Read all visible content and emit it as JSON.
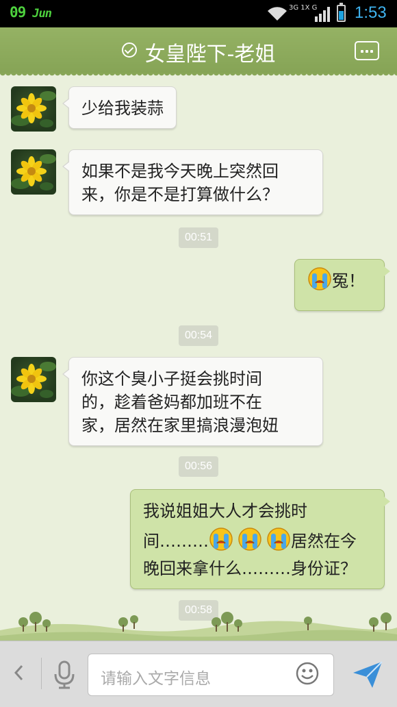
{
  "status_bar": {
    "day": "09",
    "month": "Jun",
    "network_label": "3G 1X G",
    "time": "1:53",
    "colors": {
      "date": "#4ed23e",
      "time": "#3fb3f0",
      "battery": "#1ea2e0"
    }
  },
  "header": {
    "title": "女皇陛下-老姐",
    "icons": {
      "status": "check-circle-icon",
      "menu": "more-icon"
    },
    "background": "#8ba85a"
  },
  "messages": [
    {
      "side": "in",
      "text": "少给我装蒜"
    },
    {
      "side": "in",
      "lines": [
        "如果不是我今天晚上突然回",
        "来，你是不是打算做什么？"
      ]
    },
    {
      "type": "timestamp",
      "text": "00:51"
    },
    {
      "side": "out",
      "emoji": "crying-face-icon",
      "text": "冤！"
    },
    {
      "type": "timestamp",
      "text": "00:54"
    },
    {
      "side": "in",
      "lines": [
        "你这个臭小子挺会挑时间",
        "的，趁着爸妈都加班不在",
        "家，居然在家里搞浪漫泡妞"
      ]
    },
    {
      "type": "timestamp",
      "text": "00:56"
    },
    {
      "side": "out",
      "line1": "我说姐姐大人才会挑时",
      "line2_prefix": "间………",
      "emoji_count": 3,
      "line2_suffix": "居然在今",
      "line3": "晚回来拿什么………身份证？"
    },
    {
      "type": "timestamp",
      "text": "00:58"
    }
  ],
  "input_bar": {
    "placeholder": "请输入文字信息",
    "icons": {
      "back": "chevron-left-icon",
      "voice": "microphone-icon",
      "emoji": "smiley-icon",
      "send": "send-icon"
    },
    "colors": {
      "send": "#3a8fd8"
    }
  }
}
